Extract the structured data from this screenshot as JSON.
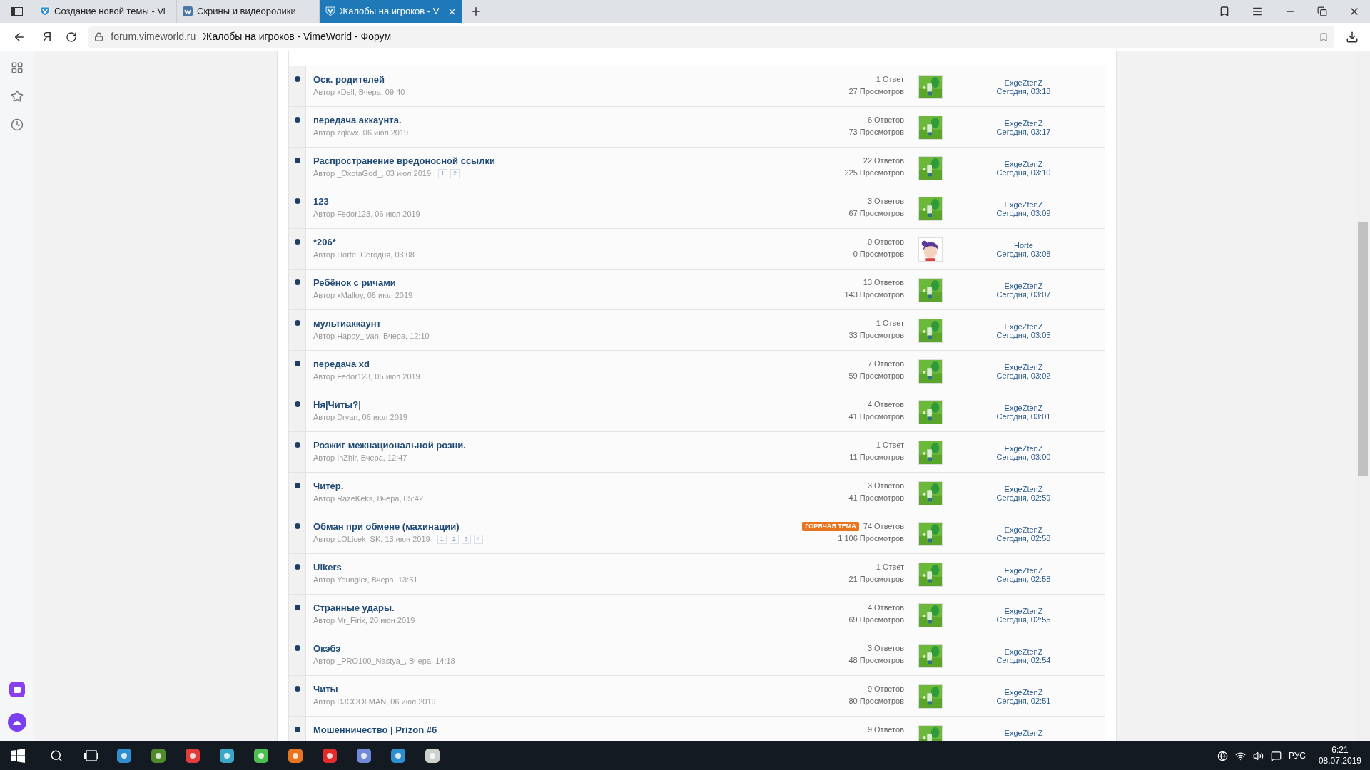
{
  "browser": {
    "tabs": [
      {
        "title": "Создание новой темы - Vi",
        "favicon": {
          "kind": "vime"
        },
        "selected": false
      },
      {
        "title": "Скрины и видеоролики",
        "favicon": {
          "kind": "vk"
        },
        "selected": false
      },
      {
        "title": "Жалобы на игроков - V",
        "favicon": {
          "kind": "vime"
        },
        "selected": true
      }
    ],
    "logo_text": "Я",
    "domain": "forum.vimeworld.ru",
    "page_title": "Жалобы на игроков - VimeWorld - Форум"
  },
  "topics": [
    {
      "title": "Оск. родителей",
      "byline": "Автор xDell, Вчера, 09:40",
      "replies": "1 Ответ",
      "views": "27 Просмотров",
      "last_user": "ExgeZtenZ",
      "last_time": "Сегодня, 03:18",
      "avatar": {
        "kind": "green"
      }
    },
    {
      "title": "передача аккаунта.",
      "byline": "Автор zqkwx, 06 июл 2019",
      "replies": "6 Ответов",
      "views": "73 Просмотров",
      "last_user": "ExgeZtenZ",
      "last_time": "Сегодня, 03:17",
      "avatar": {
        "kind": "green"
      }
    },
    {
      "title": "Распространение вредоносной ссылки",
      "byline": "Автор _OxotaGod_, 03 июл 2019",
      "pages": [
        "1",
        "2"
      ],
      "replies": "22 Ответов",
      "views": "225 Просмотров",
      "last_user": "ExgeZtenZ",
      "last_time": "Сегодня, 03:10",
      "avatar": {
        "kind": "green"
      }
    },
    {
      "title": "123",
      "byline": "Автор Fedor123, 06 июл 2019",
      "replies": "3 Ответов",
      "views": "67 Просмотров",
      "last_user": "ExgeZtenZ",
      "last_time": "Сегодня, 03:09",
      "avatar": {
        "kind": "green"
      }
    },
    {
      "title": "*206*",
      "byline": "Автор Horte, Сегодня, 03:08",
      "replies": "0 Ответов",
      "views": "0 Просмотров",
      "last_user": "Horte",
      "last_time": "Сегодня, 03:08",
      "avatar": {
        "kind": "purple"
      }
    },
    {
      "title": "Ребёнок с ричами",
      "byline": "Автор xMalloy, 06 июл 2019",
      "replies": "13 Ответов",
      "views": "143 Просмотров",
      "last_user": "ExgeZtenZ",
      "last_time": "Сегодня, 03:07",
      "avatar": {
        "kind": "green"
      }
    },
    {
      "title": "мультиаккаунт",
      "byline": "Автор Happy_Ivan, Вчера, 12:10",
      "replies": "1 Ответ",
      "views": "33 Просмотров",
      "last_user": "ExgeZtenZ",
      "last_time": "Сегодня, 03:05",
      "avatar": {
        "kind": "green"
      }
    },
    {
      "title": "передача xd",
      "byline": "Автор Fedor123, 05 июл 2019",
      "replies": "7 Ответов",
      "views": "59 Просмотров",
      "last_user": "ExgeZtenZ",
      "last_time": "Сегодня, 03:02",
      "avatar": {
        "kind": "green"
      }
    },
    {
      "title": "Ня|Читы?|",
      "byline": "Автор Dryan, 06 июл 2019",
      "replies": "4 Ответов",
      "views": "41 Просмотров",
      "last_user": "ExgeZtenZ",
      "last_time": "Сегодня, 03:01",
      "avatar": {
        "kind": "green"
      }
    },
    {
      "title": "Розжиг межнациональной розни.",
      "byline": "Автор InZhir, Вчера, 12:47",
      "replies": "1 Ответ",
      "views": "11 Просмотров",
      "last_user": "ExgeZtenZ",
      "last_time": "Сегодня, 03:00",
      "avatar": {
        "kind": "green"
      }
    },
    {
      "title": "Читер.",
      "byline": "Автор RazeKeks, Вчера, 05:42",
      "replies": "3 Ответов",
      "views": "41 Просмотров",
      "last_user": "ExgeZtenZ",
      "last_time": "Сегодня, 02:59",
      "avatar": {
        "kind": "green"
      }
    },
    {
      "title": "Обман при обмене (махинации)",
      "byline": "Автор LOLicek_SK, 13 июн 2019",
      "pages": [
        "1",
        "2",
        "3",
        "4"
      ],
      "hot": "ГОРЯЧАЯ ТЕМА",
      "replies": "74 Ответов",
      "views": "1 106 Просмотров",
      "last_user": "ExgeZtenZ",
      "last_time": "Сегодня, 02:58",
      "avatar": {
        "kind": "green"
      }
    },
    {
      "title": "Ulkers",
      "byline": "Автор Youngler, Вчера, 13:51",
      "replies": "1 Ответ",
      "views": "21 Просмотров",
      "last_user": "ExgeZtenZ",
      "last_time": "Сегодня, 02:58",
      "avatar": {
        "kind": "green"
      }
    },
    {
      "title": "Странные удары.",
      "byline": "Автор Mr_Firix, 20 июн 2019",
      "replies": "4 Ответов",
      "views": "69 Просмотров",
      "last_user": "ExgeZtenZ",
      "last_time": "Сегодня, 02:55",
      "avatar": {
        "kind": "green"
      }
    },
    {
      "title": "Окэбэ",
      "byline": "Автор _PRO100_Nastya_, Вчера, 14:18",
      "replies": "3 Ответов",
      "views": "48 Просмотров",
      "last_user": "ExgeZtenZ",
      "last_time": "Сегодня, 02:54",
      "avatar": {
        "kind": "green"
      }
    },
    {
      "title": "Читы",
      "byline": "Автор DJCOOLMAN, 06 июл 2019",
      "replies": "9 Ответов",
      "views": "80 Просмотров",
      "last_user": "ExgeZtenZ",
      "last_time": "Сегодня, 02:51",
      "avatar": {
        "kind": "green"
      }
    },
    {
      "title": "Мошенничество | Prizon #6",
      "replies": "9 Ответов",
      "last_user": "ExgeZtenZ",
      "avatar": {
        "kind": "green"
      }
    }
  ],
  "taskbar": {
    "language": "РУС",
    "time": "6:21",
    "date": "08.07.2019"
  }
}
